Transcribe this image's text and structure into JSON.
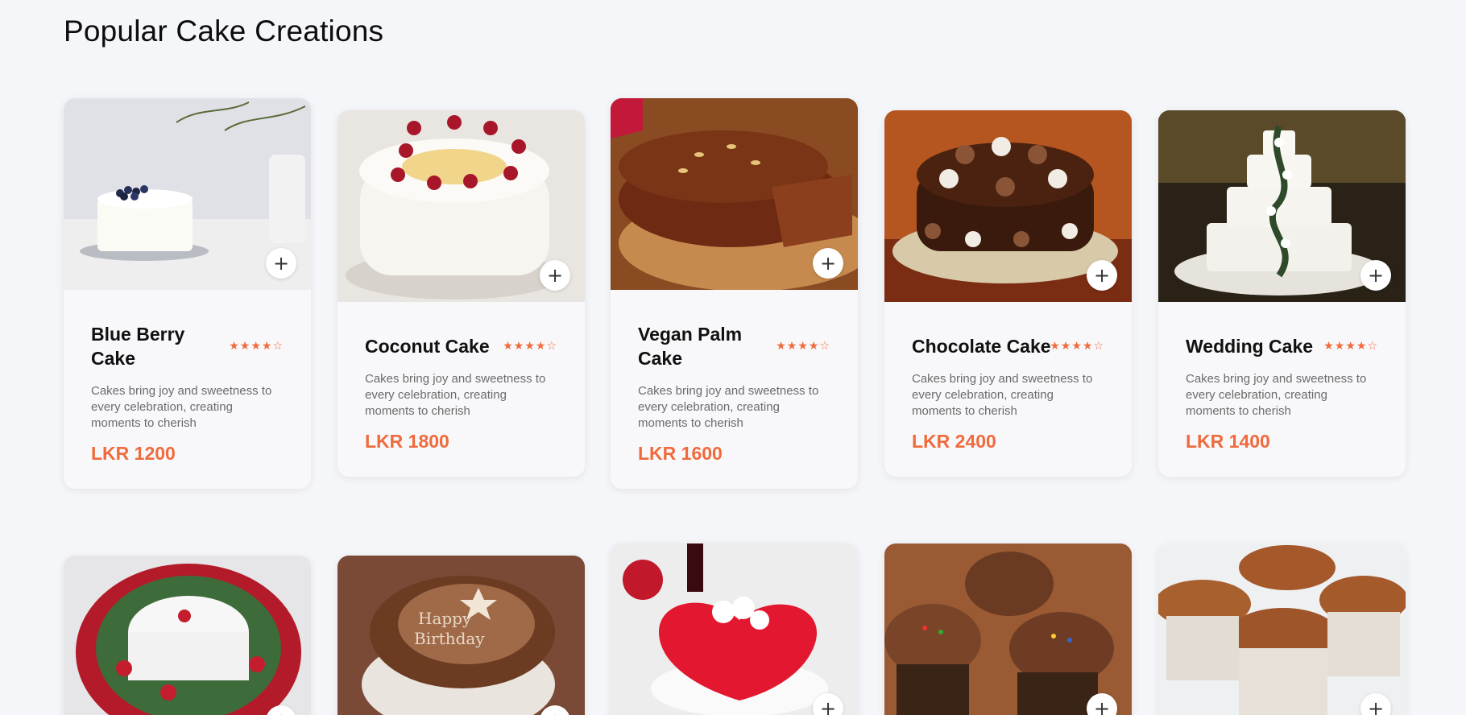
{
  "page": {
    "title": "Popular Cake Creations"
  },
  "add_button_symbol": "+",
  "accent_color": "#f06a3b",
  "cards": [
    {
      "name": "Blue Berry Cake",
      "rating": 4,
      "stars": "★★★★☆",
      "description": "Cakes bring joy and sweetness to every celebration, creating moments to cherish",
      "price": "LKR 1200"
    },
    {
      "name": "Coconut Cake",
      "rating": 4,
      "stars": "★★★★☆",
      "description": "Cakes bring joy and sweetness to every celebration, creating moments to cherish",
      "price": "LKR 1800"
    },
    {
      "name": "Vegan Palm Cake",
      "rating": 4,
      "stars": "★★★★☆",
      "description": "Cakes bring joy and sweetness to every celebration, creating moments to cherish",
      "price": "LKR 1600"
    },
    {
      "name": "Chocolate Cake",
      "rating": 4,
      "stars": "★★★★☆",
      "description": "Cakes bring joy and sweetness to every celebration, creating moments to cherish",
      "price": "LKR 2400"
    },
    {
      "name": "Wedding Cake",
      "rating": 4,
      "stars": "★★★★☆",
      "description": "Cakes bring joy and sweetness to every celebration, creating moments to cherish",
      "price": "LKR 1400"
    },
    {
      "name": "",
      "image": "christmas-cake-image"
    },
    {
      "name": "",
      "image": "birthday-cake-image"
    },
    {
      "name": "",
      "image": "heart-cake-image"
    },
    {
      "name": "",
      "image": "chocolate-cupcakes-image"
    },
    {
      "name": "",
      "image": "muffins-image"
    }
  ]
}
